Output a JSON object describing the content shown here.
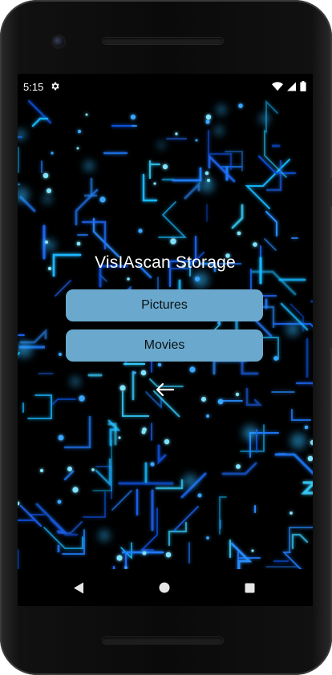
{
  "status_bar": {
    "time": "5:15",
    "icons": [
      "gear-icon",
      "wifi-icon",
      "signal-icon",
      "battery-icon"
    ]
  },
  "app": {
    "title": "VisIAscan Storage",
    "buttons": [
      {
        "label": "Pictures"
      },
      {
        "label": "Movies"
      }
    ],
    "back_icon": "arrow-left-icon",
    "button_color": "#6aa9cd",
    "background": "neon-blue-circuit"
  },
  "navbar": {
    "items": [
      "back-triangle-icon",
      "home-circle-icon",
      "recents-square-icon"
    ]
  }
}
